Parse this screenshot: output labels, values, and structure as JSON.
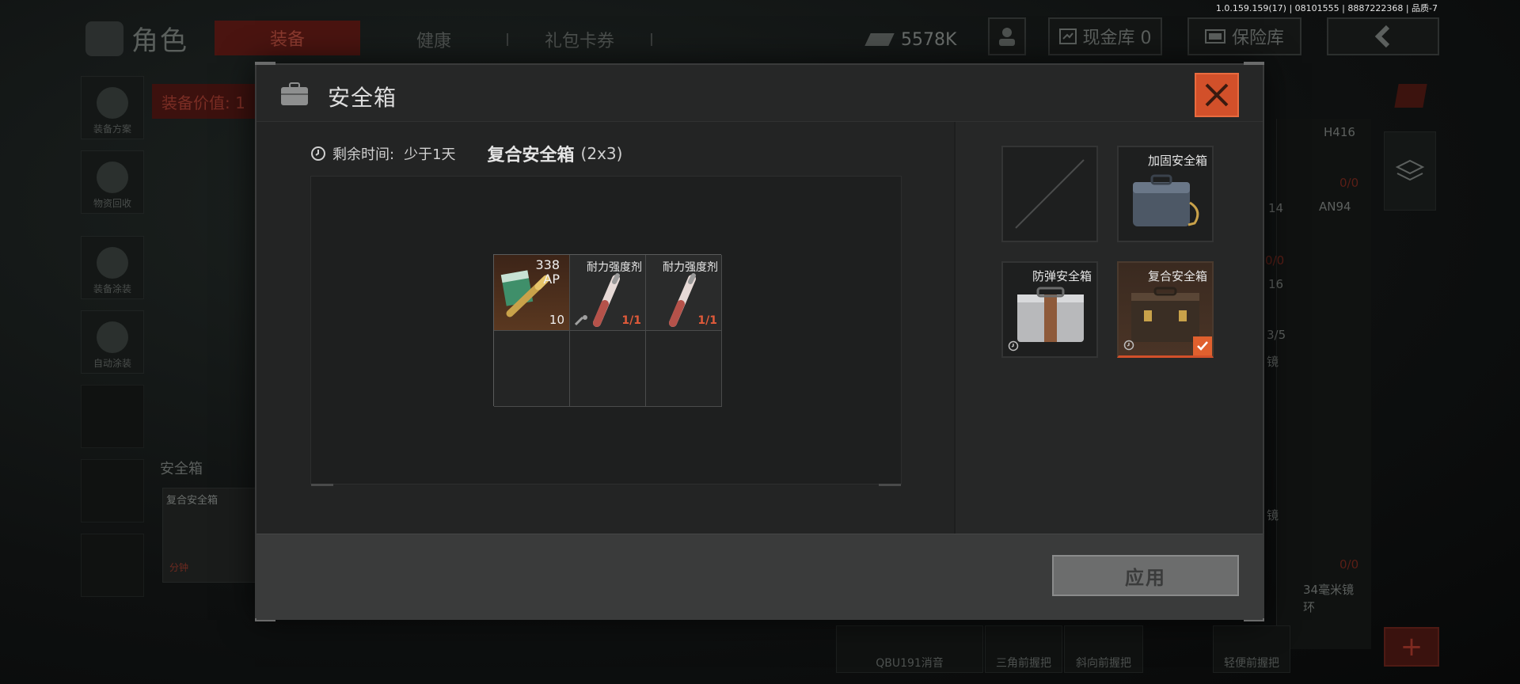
{
  "background": {
    "version": "1.0.159.159(17) | 08101555 | 8887222368 | 品质-7",
    "title": "角色",
    "tabs": {
      "active": "装备",
      "health": "健康",
      "gift": "礼包卡券"
    },
    "money": "5578K",
    "cash_vault": "现金库 0",
    "safe_vault": "保险库",
    "sidebar": [
      "装备方案",
      "物资回收",
      "装备涂装",
      "自动涂装"
    ],
    "equip_value": "装备价值: 1",
    "safebox_label": "安全箱",
    "safebox_card_name": "复合安全箱",
    "safebox_card_time": "分钟",
    "weapons": {
      "h416": "H416",
      "an94": "AN94",
      "scope": "34毫米镜环",
      "slot1": "QBU191消音",
      "slot2": "三角前握把",
      "slot3": "斜向前握把",
      "slot4": "轻便前握把",
      "n14": "14",
      "n16": "16",
      "n35": "3/5",
      "f1": "0/0",
      "f2": "0/0",
      "f3": "0/0",
      "mirror1": "镜",
      "mirror2": "镜"
    }
  },
  "modal": {
    "title": "安全箱",
    "remaining_label": "剩余时间:",
    "remaining_value": "少于1天",
    "box_name": "复合安全箱",
    "box_size": "(2x3)",
    "items": [
      {
        "type": "ammo",
        "caliber_top": "338",
        "caliber_bottom": "AP",
        "count": "10"
      },
      {
        "type": "item",
        "name": "耐力强度剂",
        "qty": "1/1"
      },
      {
        "type": "item",
        "name": "耐力强度剂",
        "qty": "1/1"
      }
    ],
    "box_options": [
      {
        "name": "",
        "icon": "empty-slot-icon"
      },
      {
        "name": "加固安全箱",
        "icon": "reinforced-case-icon"
      },
      {
        "name": "防弹安全箱",
        "icon": "bulletproof-case-icon"
      },
      {
        "name": "复合安全箱",
        "icon": "composite-case-icon",
        "selected": true
      }
    ],
    "apply_label": "应用"
  },
  "colors": {
    "accent": "#d2502a",
    "check": "#e0602e",
    "qty": "#e05a3a"
  }
}
